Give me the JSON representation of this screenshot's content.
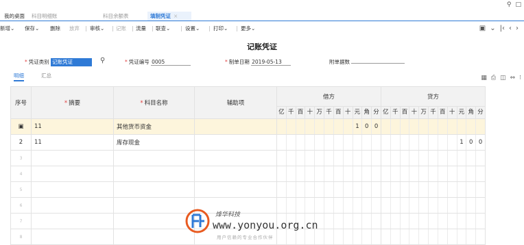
{
  "tabs": [
    {
      "label": "我的桌面"
    },
    {
      "label": "科目明细账"
    },
    {
      "label": "科目余额表"
    },
    {
      "label": "填制凭证",
      "close": "×"
    }
  ],
  "toolbar": {
    "items": [
      "新增",
      "保存",
      "删除",
      "放弃",
      "审核",
      "记账",
      "流量",
      "联查",
      "设置",
      "打印",
      "更多"
    ],
    "dropdown_mark": "⌄"
  },
  "header": {
    "title": "记账凭证",
    "voucher_type_label": "凭证类别",
    "voucher_type_value": "记账凭证",
    "voucher_no_label": "凭证编号",
    "voucher_no_value": "0005",
    "date_label": "制单日期",
    "date_value": "2019-05-13",
    "attachments_label": "附单据数",
    "attachments_value": ""
  },
  "subtabs": [
    "明细",
    "汇总"
  ],
  "table": {
    "headers": {
      "seq": "序号",
      "summary": "摘要",
      "account": "科目名称",
      "aux": "辅助项",
      "debit": "借方",
      "credit": "贷方"
    },
    "digit_units": [
      "亿",
      "千",
      "百",
      "十",
      "万",
      "千",
      "百",
      "十",
      "元",
      "角",
      "分"
    ],
    "rows": [
      {
        "seq": "▣",
        "summary": "11",
        "account": "其他货币资金",
        "aux": "",
        "debit": "100",
        "credit": ""
      },
      {
        "seq": "2",
        "summary": "11",
        "account": "库存现金",
        "aux": "",
        "debit": "",
        "credit": "100"
      },
      {
        "seq": "3",
        "summary": "",
        "account": "",
        "aux": "",
        "debit": "",
        "credit": ""
      },
      {
        "seq": "4",
        "summary": "",
        "account": "",
        "aux": "",
        "debit": "",
        "credit": ""
      },
      {
        "seq": "5",
        "summary": "",
        "account": "",
        "aux": "",
        "debit": "",
        "credit": ""
      },
      {
        "seq": "6",
        "summary": "",
        "account": "",
        "aux": "",
        "debit": "",
        "credit": ""
      },
      {
        "seq": "7",
        "summary": "",
        "account": "",
        "aux": "",
        "debit": "",
        "credit": ""
      },
      {
        "seq": "8",
        "summary": "",
        "account": "",
        "aux": "",
        "debit": "",
        "credit": ""
      }
    ]
  },
  "watermark": {
    "brand": "烽华科技",
    "url": "www.yonyou.org.cn",
    "slogan": "用户信赖的专业合作伙伴"
  },
  "colors": {
    "accent": "#2f7ad6",
    "highlight_row": "#fdf5dc",
    "required": "#e04040",
    "logo": "#e85a20"
  },
  "icons": {
    "window": [
      "search-icon",
      "restore-icon"
    ],
    "toolbar_right": [
      "scan-icon",
      "chevron-down-icon",
      "first-page-icon",
      "prev-icon",
      "next-icon"
    ],
    "table_tools": [
      "grid-icon",
      "print-icon",
      "columns-icon",
      "arrows-icon",
      "pin-icon"
    ]
  }
}
